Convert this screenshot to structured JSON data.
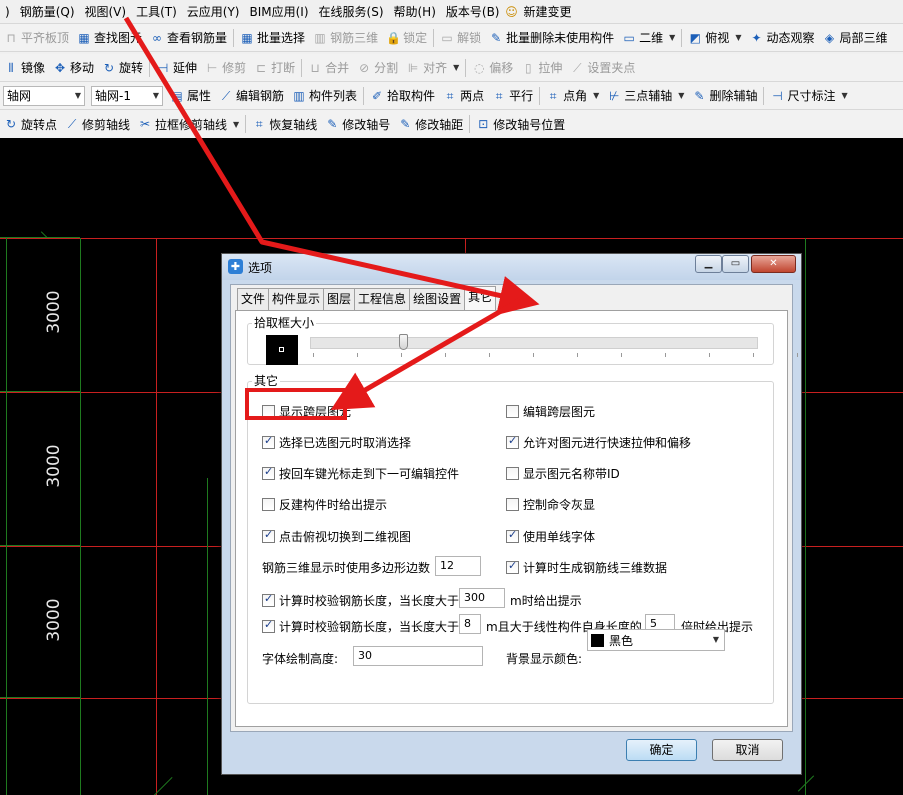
{
  "menu": [
    ")",
    "钢筋量(Q)",
    "视图(V)",
    "工具(T)",
    "云应用(Y)",
    "BIM应用(I)",
    "在线服务(S)",
    "帮助(H)",
    "版本号(B)",
    "新建变更"
  ],
  "toolbar_row2": [
    {
      "label": "平齐板顶",
      "icon": "⊓",
      "disabled": true
    },
    {
      "label": "查找图元",
      "icon": "▦",
      "disabled": false
    },
    {
      "label": "查看钢筋量",
      "icon": "∞",
      "disabled": false
    },
    {
      "label": "批量选择",
      "icon": "▦",
      "disabled": false
    },
    {
      "label": "钢筋三维",
      "icon": "▥",
      "disabled": true
    },
    {
      "label": "锁定",
      "icon": "🔒",
      "disabled": true
    },
    {
      "label": "解锁",
      "icon": "▭",
      "disabled": true
    },
    {
      "label": "批量删除未使用构件",
      "icon": "✎",
      "disabled": false
    },
    {
      "label": "二维",
      "icon": "▭",
      "disabled": false,
      "dropdown": true
    },
    {
      "label": "俯视",
      "icon": "◩",
      "disabled": false,
      "dropdown": true
    },
    {
      "label": "动态观察",
      "icon": "✦",
      "disabled": false
    },
    {
      "label": "局部三维",
      "icon": "◈",
      "disabled": false
    }
  ],
  "toolbar_row3": [
    {
      "label": "镜像",
      "icon": "⫴",
      "disabled": false
    },
    {
      "label": "移动",
      "icon": "✥",
      "disabled": false
    },
    {
      "label": "旋转",
      "icon": "↻",
      "disabled": false
    },
    {
      "label": "延伸",
      "icon": "⊣",
      "disabled": false
    },
    {
      "label": "修剪",
      "icon": "⊢",
      "disabled": true
    },
    {
      "label": "打断",
      "icon": "⊏",
      "disabled": true
    },
    {
      "label": "合并",
      "icon": "⊔",
      "disabled": true
    },
    {
      "label": "分割",
      "icon": "⊘",
      "disabled": true
    },
    {
      "label": "对齐",
      "icon": "⊫",
      "disabled": true,
      "dropdown": true
    },
    {
      "label": "偏移",
      "icon": "◌",
      "disabled": true
    },
    {
      "label": "拉伸",
      "icon": "▯",
      "disabled": true
    },
    {
      "label": "设置夹点",
      "icon": "⟋",
      "disabled": true
    }
  ],
  "toolbar_row4": {
    "combo1": "轴网",
    "combo2": "轴网-1",
    "buttons": [
      {
        "label": "属性",
        "icon": "▤"
      },
      {
        "label": "编辑钢筋",
        "icon": "⟋"
      },
      {
        "label": "构件列表",
        "icon": "▥"
      },
      {
        "label": "拾取构件",
        "icon": "✐"
      },
      {
        "label": "两点",
        "icon": "⌗"
      },
      {
        "label": "平行",
        "icon": "⌗"
      },
      {
        "label": "点角",
        "icon": "⌗",
        "dropdown": true
      },
      {
        "label": "三点辅轴",
        "icon": "⊬",
        "dropdown": true
      },
      {
        "label": "删除辅轴",
        "icon": "✎"
      },
      {
        "label": "尺寸标注",
        "icon": "⊣",
        "dropdown": true
      }
    ]
  },
  "toolbar_row5": [
    {
      "label": "旋转点",
      "icon": "↻"
    },
    {
      "label": "修剪轴线",
      "icon": "⟋"
    },
    {
      "label": "拉框修剪轴线",
      "icon": "✂",
      "dropdown": true
    },
    {
      "label": "恢复轴线",
      "icon": "⌗"
    },
    {
      "label": "修改轴号",
      "icon": "✎"
    },
    {
      "label": "修改轴距",
      "icon": "✎"
    },
    {
      "label": "修改轴号位置",
      "icon": "⊡"
    }
  ],
  "canvas": {
    "dim_labels": [
      "3000",
      "3000",
      "3000"
    ],
    "grid_color": "#1f7a1f",
    "line_color": "#c82020"
  },
  "dialog": {
    "title": "选项",
    "tabs": [
      "文件",
      "构件显示",
      "图层",
      "工程信息",
      "绘图设置",
      "其它"
    ],
    "active_tab": "其它",
    "pick_group_title": "拾取框大小",
    "pick_slider_level": 0.2,
    "other_group_title": "其它",
    "checkboxes": [
      {
        "label": "显示跨层图元",
        "checked": false
      },
      {
        "label": "编辑跨层图元",
        "checked": false
      },
      {
        "label": "选择已选图元时取消选择",
        "checked": true
      },
      {
        "label": "允许对图元进行快速拉伸和偏移",
        "checked": true
      },
      {
        "label": "按回车键光标走到下一可编辑控件",
        "checked": true
      },
      {
        "label": "显示图元名称带ID",
        "checked": false
      },
      {
        "label": "反建构件时给出提示",
        "checked": false
      },
      {
        "label": "控制命令灰显",
        "checked": false
      },
      {
        "label": "点击俯视切换到二维视图",
        "checked": true
      },
      {
        "label": "使用单线字体",
        "checked": true
      },
      {
        "label": "计算时生成钢筋线三维数据",
        "checked": true
      },
      {
        "label": "计算时校验钢筋长度，当长度大于",
        "checked": true
      },
      {
        "label": "计算时校验钢筋长度，当长度大于",
        "checked": true
      }
    ],
    "polygon_edges_label": "钢筋三维显示时使用多边形边数",
    "polygon_edges_value": "12",
    "check1_value": "300",
    "check1_suffix": "m时给出提示",
    "check2_value": "8",
    "check2_mid": "m且大于线性构件自身长度的",
    "check2_value2": "5",
    "check2_suffix": "倍时给出提示",
    "font_height_label": "字体绘制高度:",
    "font_height_value": "30",
    "bg_color_label": "背景显示颜色:",
    "bg_color_value": "黑色",
    "ok_label": "确定",
    "cancel_label": "取消"
  },
  "colors": {
    "annotation_red": "#e41a1a",
    "dialog_frame": "#c9d9ec"
  }
}
